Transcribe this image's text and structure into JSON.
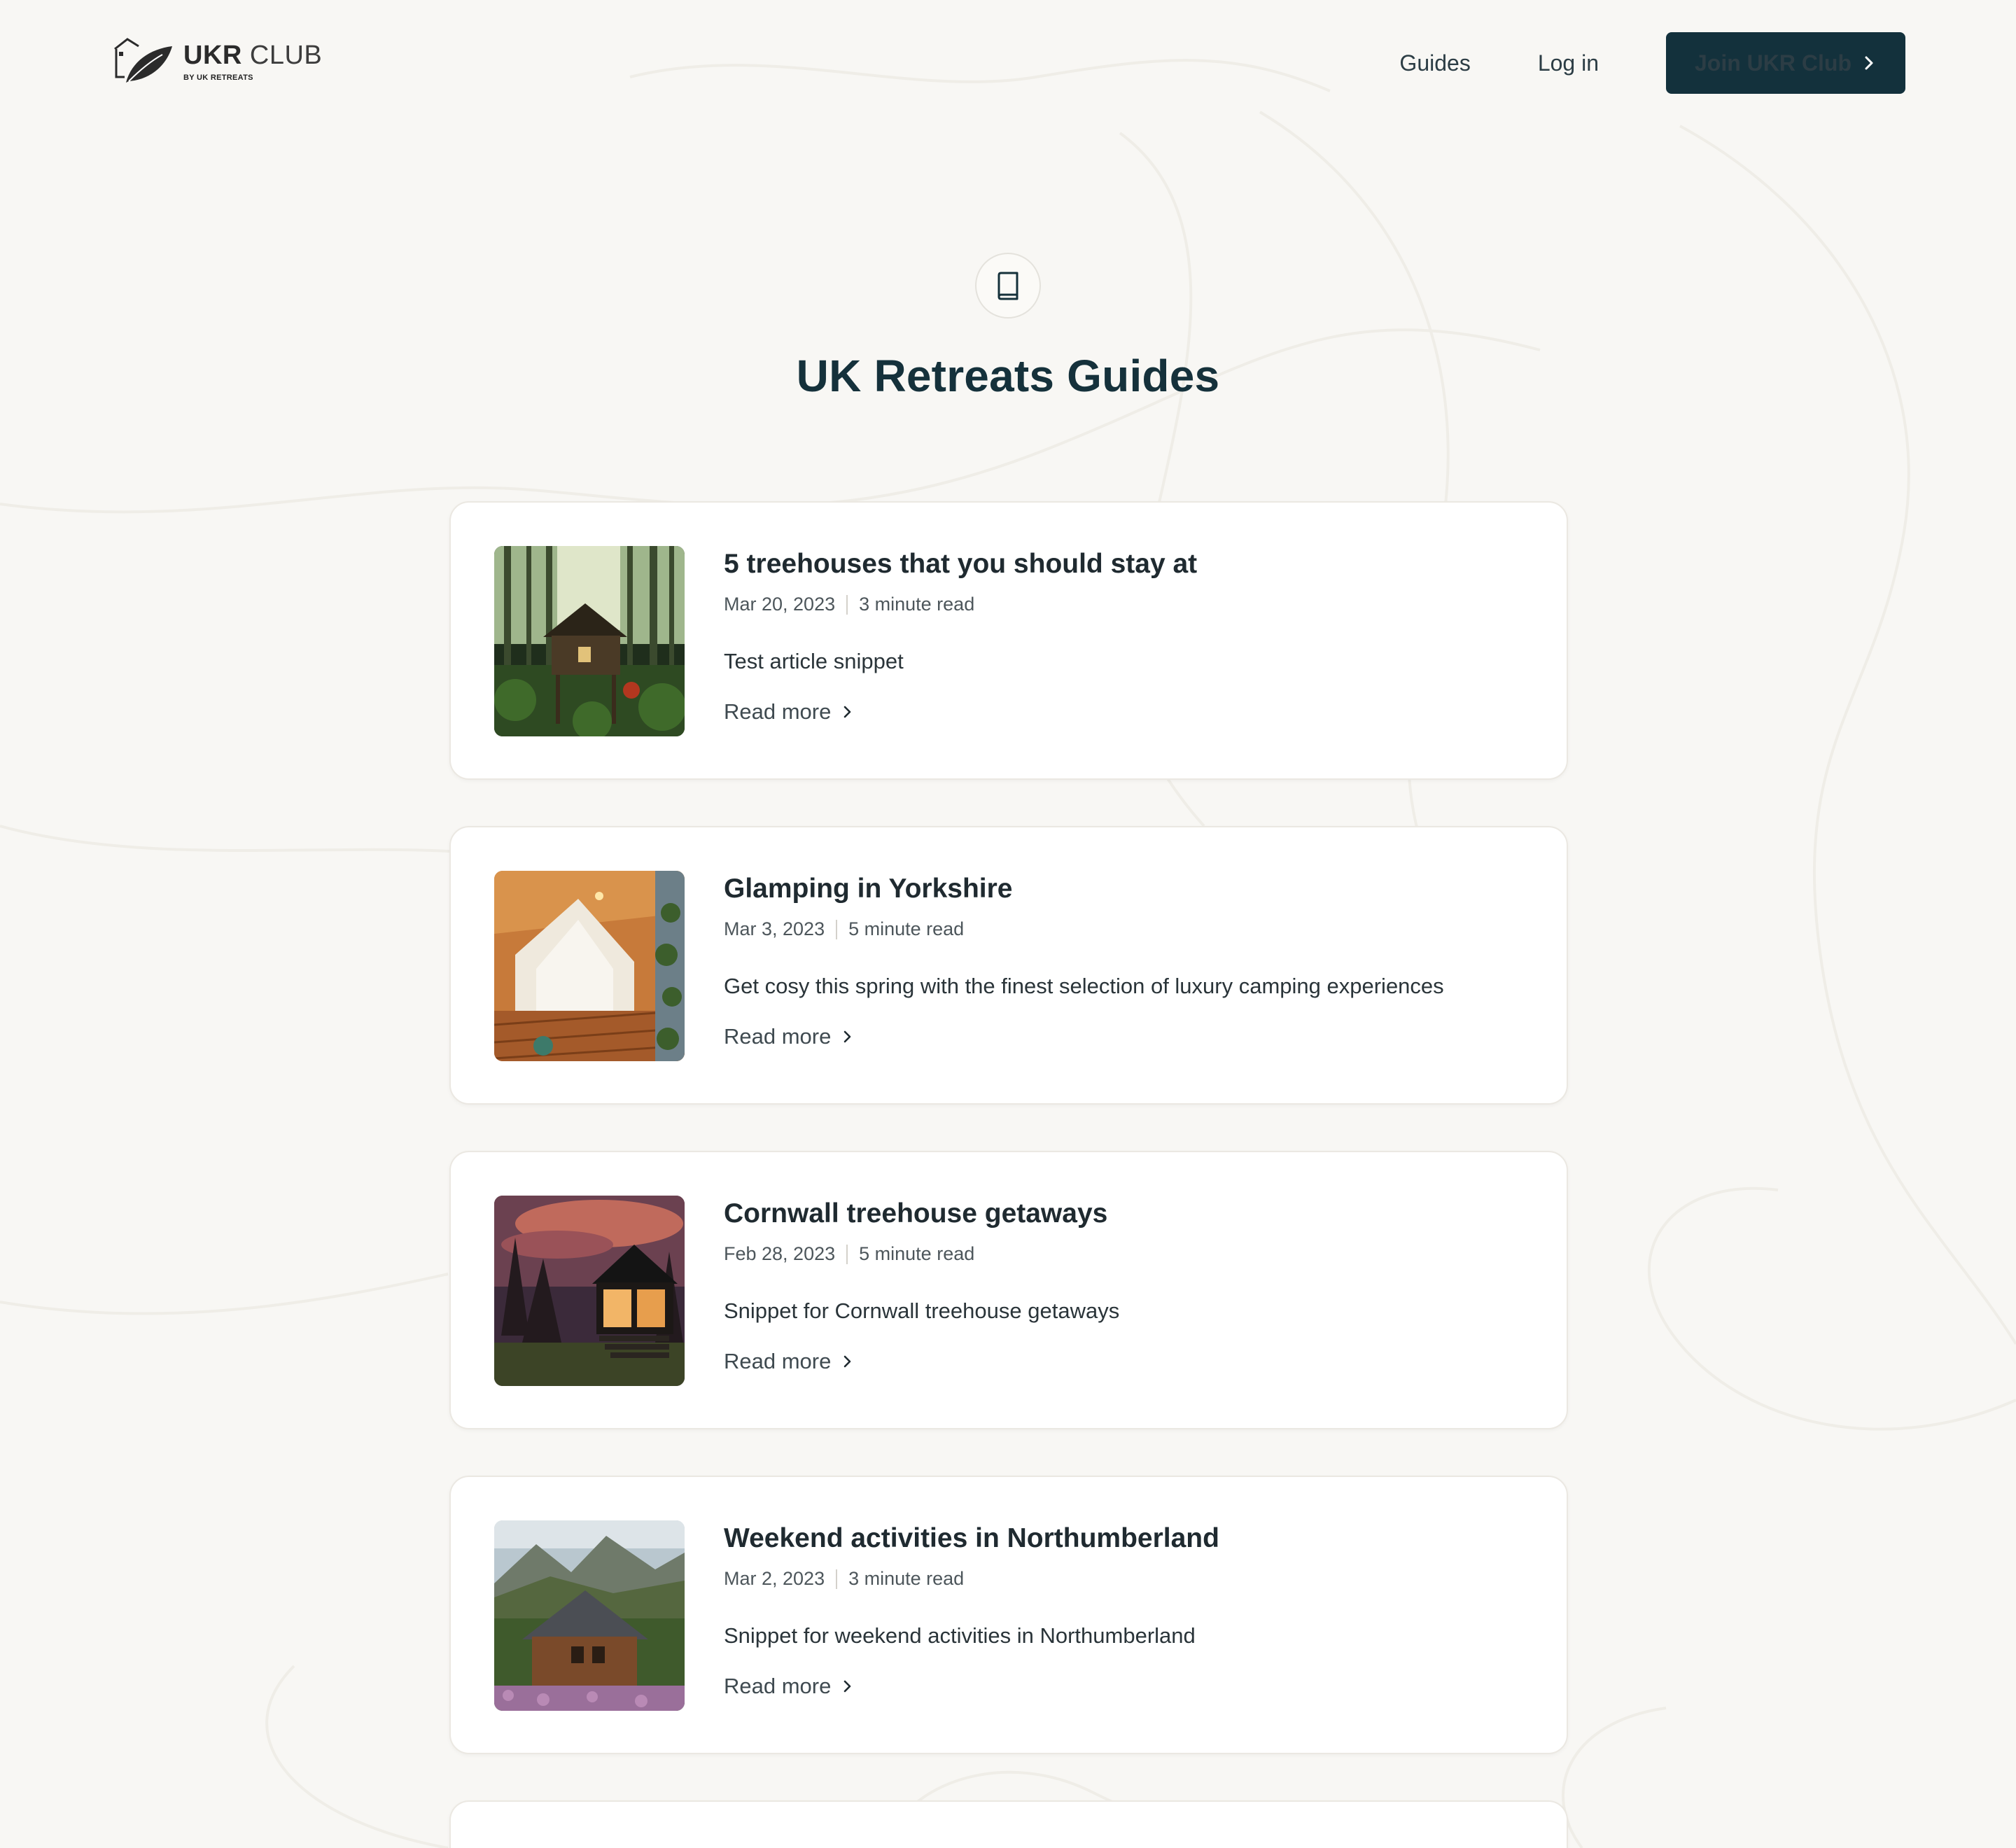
{
  "header": {
    "logo": {
      "brand_bold": "UKR",
      "brand_light": "CLUB",
      "sub": "BY UK RETREATS",
      "icon": "leaf-house-icon"
    },
    "nav": {
      "guides_label": "Guides",
      "login_label": "Log in",
      "join_label": "Join UKR Club",
      "join_icon": "chevron-right-icon"
    }
  },
  "hero": {
    "icon": "book-icon",
    "title": "UK Retreats Guides"
  },
  "guides": [
    {
      "title": "5 treehouses that you should stay at",
      "date": "Mar 20, 2023",
      "read_time": "3 minute read",
      "snippet": "Test article snippet",
      "link_label": "Read more",
      "image": "forest-treehouse-photo"
    },
    {
      "title": "Glamping in Yorkshire",
      "date": "Mar 3, 2023",
      "read_time": "5 minute read",
      "snippet": "Get cosy this spring with the finest selection of luxury camping experiences",
      "link_label": "Read more",
      "image": "glamping-tent-photo"
    },
    {
      "title": "Cornwall treehouse getaways",
      "date": "Feb 28, 2023",
      "read_time": "5 minute read",
      "snippet": "Snippet for Cornwall treehouse getaways",
      "link_label": "Read more",
      "image": "cabin-sunset-photo"
    },
    {
      "title": "Weekend activities in Northumberland",
      "date": "Mar 2, 2023",
      "read_time": "3 minute read",
      "snippet": "Snippet for weekend activities in Northumberland",
      "link_label": "Read more",
      "image": "mountain-cabin-photo"
    }
  ],
  "colors": {
    "background": "#f8f7f4",
    "primary": "#13313c",
    "title": "#15313b",
    "card": "#ffffff",
    "card_border": "#ebe8e2"
  }
}
